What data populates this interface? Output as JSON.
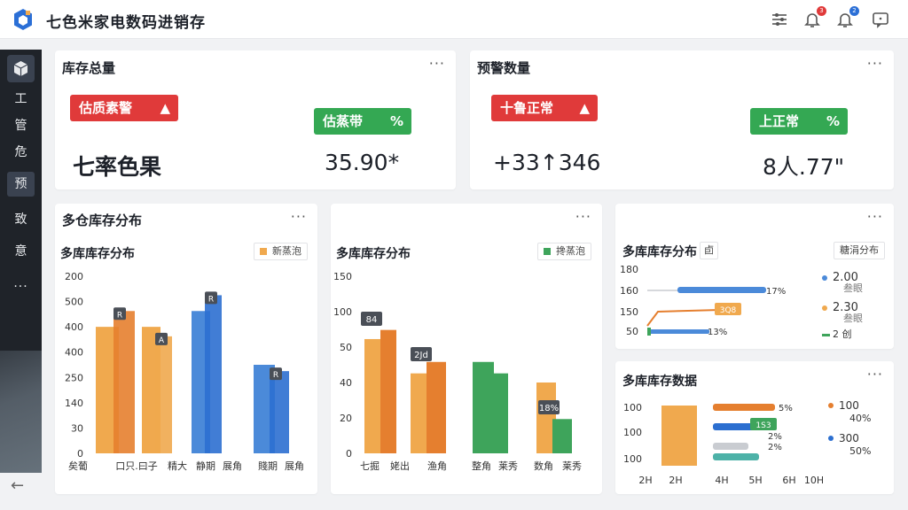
{
  "app": {
    "title": "七色米家电数码进销存"
  },
  "header": {
    "icons": [
      {
        "name": "filter-icon"
      },
      {
        "name": "bell-icon",
        "badge": "3",
        "badge_color": "#e03a3a"
      },
      {
        "name": "notification-icon",
        "badge": "2",
        "badge_color": "#2b6fd6"
      },
      {
        "name": "message-icon"
      }
    ]
  },
  "sidebar": {
    "items": [
      {
        "label": "工",
        "active": false
      },
      {
        "label": "管",
        "active": false
      },
      {
        "label": "危",
        "active": false
      },
      {
        "label": "预",
        "active": true
      },
      {
        "label": "致",
        "active": false
      },
      {
        "label": "意",
        "active": false
      }
    ],
    "more": "..."
  },
  "cards": {
    "total": {
      "title": "库存总量",
      "red_pill": "估质素警",
      "green_pill": "估蒸带",
      "value_left": "七率色果",
      "value_right": "35.90*"
    },
    "warning": {
      "title": "预警数量",
      "red_pill": "十鲁正常",
      "green_pill": "上正常",
      "value_left": "+33↑346",
      "value_right": "8人.77\""
    },
    "dist1": {
      "title": "多仓库存分布",
      "sub_title": "多库库存分布",
      "tag": "新蒸泡"
    },
    "dist2": {
      "sub_title": "多库库存分布",
      "tag": "搀蒸泡"
    },
    "dist3": {
      "sub_title": "多库库存分布",
      "sub_icon": "卣",
      "tag": "糖涓分布"
    },
    "dist4": {
      "sub_title": "多库库存数据"
    }
  },
  "colors": {
    "orange": "#f0a94e",
    "orange_dark": "#e57f2f",
    "blue": "#4b8ad9",
    "blue_dark": "#2c6fd0",
    "green": "#3ea45b",
    "teal": "#4db2a8"
  },
  "chart_data": [
    {
      "type": "bar",
      "title": "多库库存分布",
      "categories": [
        "矣葡",
        "口只.曰子",
        "精大",
        "静期",
        "展角",
        "賤期",
        "展角"
      ],
      "yticks": [
        "0",
        "30",
        "140",
        "250",
        "400",
        "400",
        "500",
        "200"
      ],
      "series": [
        {
          "name": "A",
          "values": [
            400,
            450,
            400,
            450,
            500,
            280,
            260
          ]
        }
      ],
      "data_labels": [
        "R",
        "A",
        "R",
        "R",
        "R",
        "R"
      ]
    },
    {
      "type": "bar",
      "title": "多库库存分布",
      "categories": [
        "七掘",
        "姥出",
        "渔角",
        "整角",
        "莱秀",
        "数角",
        "莱秀"
      ],
      "yticks": [
        "0",
        "20",
        "40",
        "50",
        "100",
        "150"
      ],
      "series": [
        {
          "values": [
            60,
            55,
            55,
            50,
            50,
            40,
            30
          ]
        }
      ],
      "data_labels": [
        "84",
        "2Jd",
        "18%"
      ]
    },
    {
      "type": "line",
      "title": "多库库存分布",
      "yticks": [
        "50",
        "150",
        "160",
        "180"
      ],
      "bar_labels": [
        "17%",
        "3Q8",
        "13%"
      ],
      "legend": [
        {
          "value": "2.00",
          "label": "叁眼"
        },
        {
          "value": "2.30",
          "label": "叁眼"
        },
        {
          "value": "",
          "label": "2 创"
        }
      ]
    },
    {
      "type": "bar",
      "title": "多库库存数据",
      "categories": [
        "2H",
        "2H",
        "4H",
        "5H",
        "6H",
        "10H"
      ],
      "yticks": [
        "100",
        "100",
        "100"
      ],
      "bar_labels": [
        "5%",
        "1S3",
        "2%",
        "2%"
      ],
      "legend": [
        {
          "value": "100",
          "pct": "40%"
        },
        {
          "value": "300",
          "pct": "50%"
        }
      ]
    }
  ]
}
